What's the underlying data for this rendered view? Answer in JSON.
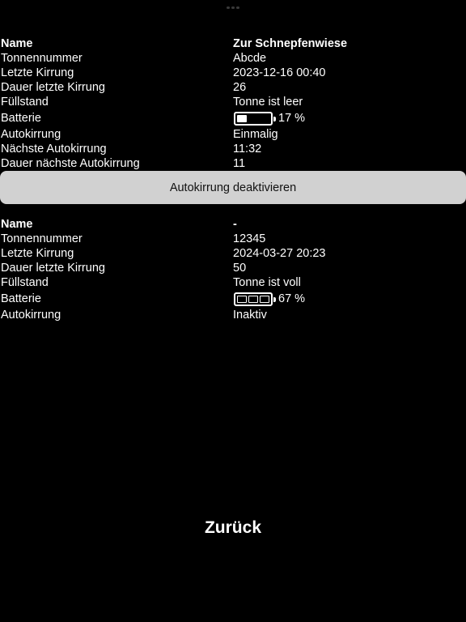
{
  "devices": [
    {
      "rows": [
        {
          "label": "Name",
          "value": "Zur Schnepfenwiese"
        },
        {
          "label": "Tonnennummer",
          "value": "Abcde"
        },
        {
          "label": "Letzte Kirrung",
          "value": "2023-12-16 00:40"
        },
        {
          "label": "Dauer letzte Kirrung",
          "value": "26"
        },
        {
          "label": "Füllstand",
          "value": "Tonne ist leer"
        },
        {
          "label": "Batterie",
          "value": "17 %"
        },
        {
          "label": "Autokirrung",
          "value": "Einmalig"
        },
        {
          "label": "Nächste Autokirrung",
          "value": "11:32"
        },
        {
          "label": "Dauer nächste Autokirrung",
          "value": "11"
        }
      ],
      "battery_level": 0.17
    },
    {
      "rows": [
        {
          "label": "Name",
          "value": "-"
        },
        {
          "label": "Tonnennummer",
          "value": "12345"
        },
        {
          "label": "Letzte Kirrung",
          "value": "2024-03-27 20:23"
        },
        {
          "label": "Dauer letzte Kirrung",
          "value": "50"
        },
        {
          "label": "Füllstand",
          "value": "Tonne ist voll"
        },
        {
          "label": "Batterie",
          "value": "67 %"
        },
        {
          "label": "Autokirrung",
          "value": "Inaktiv"
        }
      ],
      "battery_level": 0.67
    }
  ],
  "action_button_label": "Autokirrung deaktivieren",
  "back_button_label": "Zurück",
  "icons": {
    "battery": "battery-icon"
  },
  "colors": {
    "background": "#000000",
    "text": "#ffffff",
    "button_bg": "#d1d1d1",
    "button_text": "#111111"
  }
}
